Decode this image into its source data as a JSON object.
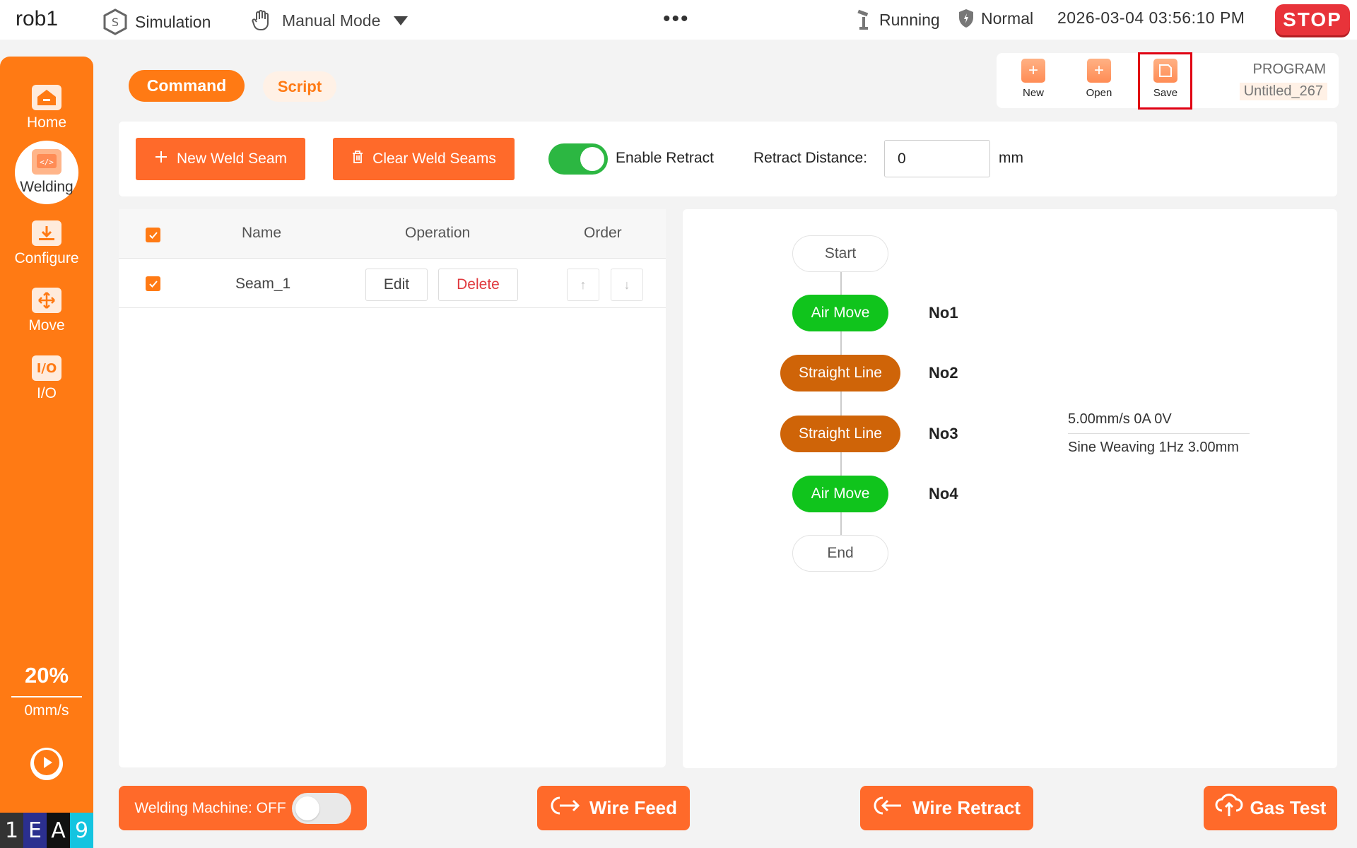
{
  "topbar": {
    "robot_name": "rob1",
    "simulation_label": "Simulation",
    "mode_label": "Manual Mode",
    "more": "•••",
    "running_label": "Running",
    "normal_label": "Normal",
    "datetime": "2026-03-04 03:56:10 PM",
    "stop_label": "STOP"
  },
  "sidebar": {
    "items": [
      {
        "label": "Home",
        "icon": "home-icon"
      },
      {
        "label": "Welding",
        "icon": "code-icon"
      },
      {
        "label": "Configure",
        "icon": "download-icon"
      },
      {
        "label": "Move",
        "icon": "move-icon"
      },
      {
        "label": "I/O",
        "icon": "io-icon"
      }
    ],
    "speed_percent": "20%",
    "speed_value": "0mm/s",
    "logo": [
      "1",
      "E",
      "A",
      "9"
    ]
  },
  "tabs": {
    "command": "Command",
    "script": "Script"
  },
  "program": {
    "new_label": "New",
    "open_label": "Open",
    "save_label": "Save",
    "program_label": "PROGRAM",
    "program_name": "Untitled_267"
  },
  "toolbar": {
    "new_weld_seam": "New Weld Seam",
    "clear_weld_seams": "Clear Weld Seams",
    "enable_retract": "Enable Retract",
    "retract_distance_label": "Retract Distance:",
    "retract_distance_value": "0",
    "unit": "mm"
  },
  "table": {
    "headers": {
      "name": "Name",
      "operation": "Operation",
      "order": "Order"
    },
    "rows": [
      {
        "name": "Seam_1",
        "edit": "Edit",
        "delete": "Delete",
        "up": "↑",
        "down": "↓"
      }
    ]
  },
  "flow": {
    "start": "Start",
    "end": "End",
    "nodes": [
      {
        "label": "Air Move",
        "no": "No1"
      },
      {
        "label": "Straight Line",
        "no": "No2"
      },
      {
        "label": "Straight Line",
        "no": "No3"
      },
      {
        "label": "Air Move",
        "no": "No4"
      }
    ],
    "info_line1": "5.00mm/s 0A 0V",
    "info_line2": "Sine Weaving 1Hz 3.00mm"
  },
  "bottom": {
    "welding_machine": "Welding Machine: OFF",
    "wire_feed": "Wire Feed",
    "wire_retract": "Wire Retract",
    "gas_test": "Gas Test"
  },
  "colors": {
    "accent": "#ff7a14",
    "button": "#ff6a2a",
    "air_move": "#10c41c",
    "straight_line": "#cf6408",
    "stop": "#e8333a",
    "toggle_on": "#2cb742"
  }
}
